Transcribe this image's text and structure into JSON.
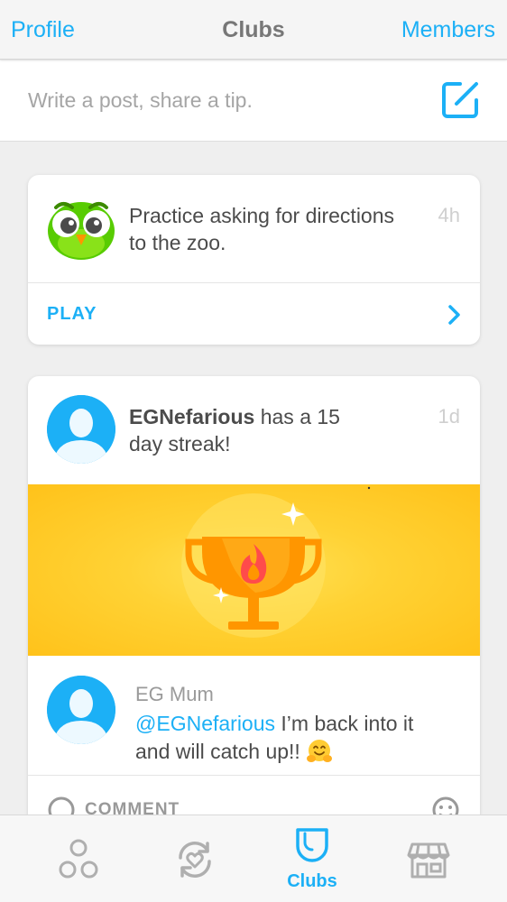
{
  "topbar": {
    "left_label": "Profile",
    "title": "Clubs",
    "right_label": "Members"
  },
  "composer": {
    "placeholder": "Write a post, share a tip.",
    "edit_icon": "compose-icon"
  },
  "feed": {
    "practice_card": {
      "avatar_icon": "owl-mascot-icon",
      "message": "Practice asking for directions to the zoo.",
      "time": "4h",
      "action_label": "PLAY",
      "action_icon": "chevron-right-icon"
    },
    "streak_card": {
      "user": "EGNefarious",
      "message_suffix": " has a 15 day streak!",
      "time": "1d",
      "banner_icon": "trophy-flame-icon",
      "comment": {
        "author": "EG Mum",
        "mention": "@EGNefarious",
        "text": " I’m back into it and will catch up!! ",
        "emoji_icon": "hugging-face-emoji"
      },
      "comment_button_label": "COMMENT",
      "react_icon": "smiley-icon"
    }
  },
  "bottom_nav": {
    "items": [
      {
        "icon": "learn-circles-icon",
        "label": ""
      },
      {
        "icon": "practice-heart-refresh-icon",
        "label": ""
      },
      {
        "icon": "clubs-shield-icon",
        "label": "Clubs",
        "active": true
      },
      {
        "icon": "shop-storefront-icon",
        "label": ""
      }
    ]
  },
  "colors": {
    "accent_blue": "#1cb0f6",
    "banner_yellow": "#ffc800",
    "trophy_orange": "#ff9600"
  }
}
